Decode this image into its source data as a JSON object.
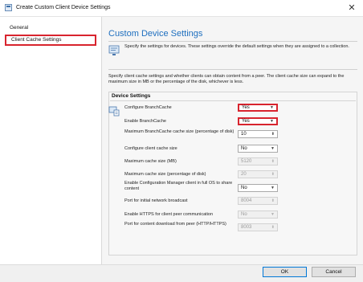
{
  "window": {
    "title": "Create Custom Client Device Settings",
    "close_glyph": "✕"
  },
  "sidebar": {
    "items": [
      {
        "label": "General"
      },
      {
        "label": "Client Cache Settings",
        "selected": true
      }
    ]
  },
  "main": {
    "heading": "Custom Device Settings",
    "intro": "Specify the settings for devices. These settings override the default settings when they are assigned to a collection.",
    "description": "Specify client cache settings and whether clients can obtain content from a peer. The client cache size can expand to the maximum size in MB or the percentage of the disk, whichever is less.",
    "group_title": "Device Settings",
    "settings": [
      {
        "label": "Configure BranchCache",
        "value": "Yes",
        "control": "dropdown"
      },
      {
        "label": "Enable BranchCache",
        "value": "Yes",
        "control": "dropdown"
      },
      {
        "label": "Maximum BranchCache cache size (percentage of disk)",
        "value": "10",
        "control": "spinner"
      },
      {
        "label": "Configure client cache size",
        "value": "No",
        "control": "dropdown"
      },
      {
        "label": "Maximum cache size (MB)",
        "value": "5120",
        "control": "spinner",
        "disabled": true
      },
      {
        "label": "Maximum cache size (percentage of disk)",
        "value": "20",
        "control": "spinner",
        "disabled": true
      },
      {
        "label": "Enable Configuration Manager client in full OS to share content",
        "value": "No",
        "control": "dropdown"
      },
      {
        "label": "Port for initial network broadcast",
        "value": "8004",
        "control": "spinner",
        "disabled": true
      },
      {
        "label": "Enable HTTPS for client peer communication",
        "value": "No",
        "control": "dropdown",
        "disabled": true
      },
      {
        "label": "Port for content download from peer (HTTP/HTTPS)",
        "value": "8003",
        "control": "spinner",
        "disabled": true
      }
    ]
  },
  "footer": {
    "ok_label": "OK",
    "cancel_label": "Cancel"
  },
  "colors": {
    "accent": "#1e6fbf",
    "highlight": "#d8242e"
  }
}
